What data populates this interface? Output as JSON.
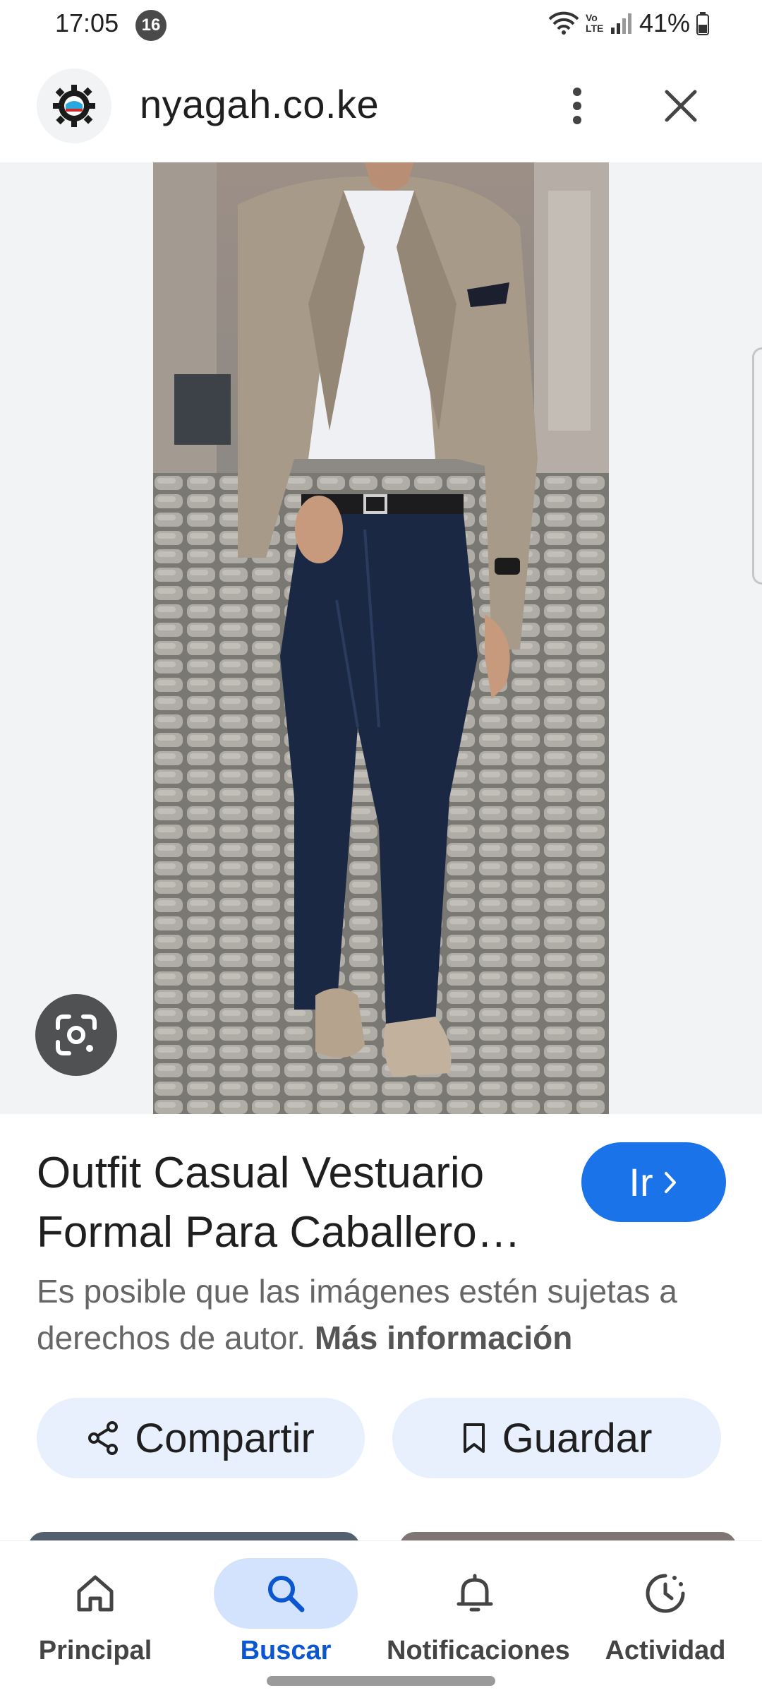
{
  "status_bar": {
    "time": "17:05",
    "notification_count": "16",
    "network_label": "Vo LTE",
    "battery": "41%"
  },
  "browser": {
    "domain": "nyagah.co.ke",
    "favicon": "site-logo-gear"
  },
  "result": {
    "title_line1": "Outfit Casual Vestuario",
    "title_line2": "Formal Para Caballero…",
    "go_label": "Ir",
    "notice_text": "Es posible que las imágenes estén sujetas a derechos de autor.",
    "notice_link": "Más información"
  },
  "actions": {
    "share_label": "Compartir",
    "save_label": "Guardar"
  },
  "nav": {
    "items": [
      {
        "label": "Principal",
        "icon": "home-icon"
      },
      {
        "label": "Buscar",
        "icon": "search-icon"
      },
      {
        "label": "Notificaciones",
        "icon": "bell-icon"
      },
      {
        "label": "Actividad",
        "icon": "activity-icon"
      }
    ],
    "active": "Buscar"
  },
  "colors": {
    "accent": "#1a73e8",
    "chip_bg": "#e8f0fe",
    "nav_active_bg": "#d3e3fd",
    "nav_active_text": "#0b57d0"
  }
}
